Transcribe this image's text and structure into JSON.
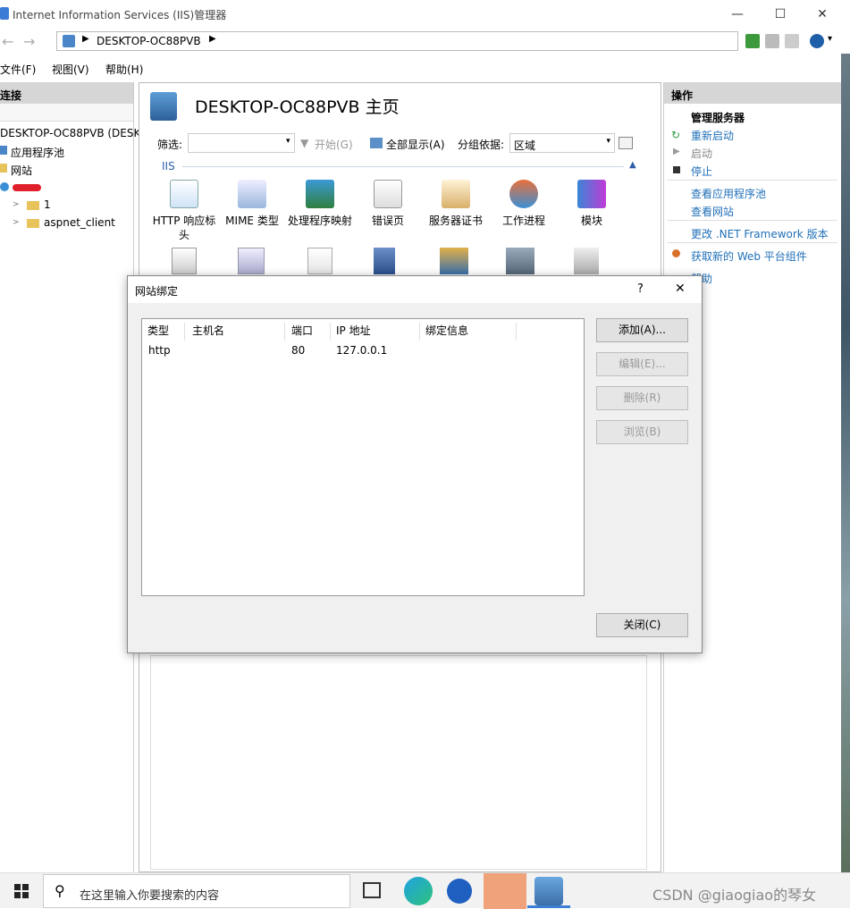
{
  "window": {
    "title": "Internet Information Services (IIS)管理器"
  },
  "address": {
    "crumb": "DESKTOP-OC88PVB"
  },
  "menu": [
    "文件(F)",
    "视图(V)",
    "帮助(H)"
  ],
  "connections": {
    "header": "连接",
    "tree": [
      "DESKTOP-OC88PVB (DESKT",
      "应用程序池",
      "网站",
      "1",
      "aspnet_client"
    ]
  },
  "center": {
    "title": "DESKTOP-OC88PVB 主页",
    "filter_label": "筛选:",
    "start_label": "开始(G)",
    "show_all_label": "全部显示(A)",
    "group_label": "分组依据:",
    "group_value": "区域",
    "section": "IIS",
    "features": [
      "HTTP 响应标头",
      "MIME 类型",
      "处理程序映射",
      "错误页",
      "服务器证书",
      "工作进程",
      "模块"
    ]
  },
  "actions": {
    "header": "操作",
    "group_title": "管理服务器",
    "items": [
      "重新启动",
      "启动",
      "停止",
      "查看应用程序池",
      "查看网站",
      "更改 .NET Framework 版本",
      "获取新的 Web 平台组件",
      "帮助"
    ]
  },
  "dialog": {
    "title": "网站绑定",
    "help": "?",
    "close_glyph": "✕",
    "columns": [
      "类型",
      "主机名",
      "端口",
      "IP 地址",
      "绑定信息"
    ],
    "rows": [
      {
        "type": "http",
        "host": "",
        "port": "80",
        "ip": "127.0.0.1",
        "info": ""
      }
    ],
    "buttons": {
      "add": "添加(A)...",
      "edit": "编辑(E)...",
      "remove": "删除(R)",
      "browse": "浏览(B)",
      "close": "关闭(C)"
    }
  },
  "taskbar": {
    "search_placeholder": "在这里输入你要搜索的内容",
    "watermark": "CSDN @giaogiao的琴女"
  }
}
